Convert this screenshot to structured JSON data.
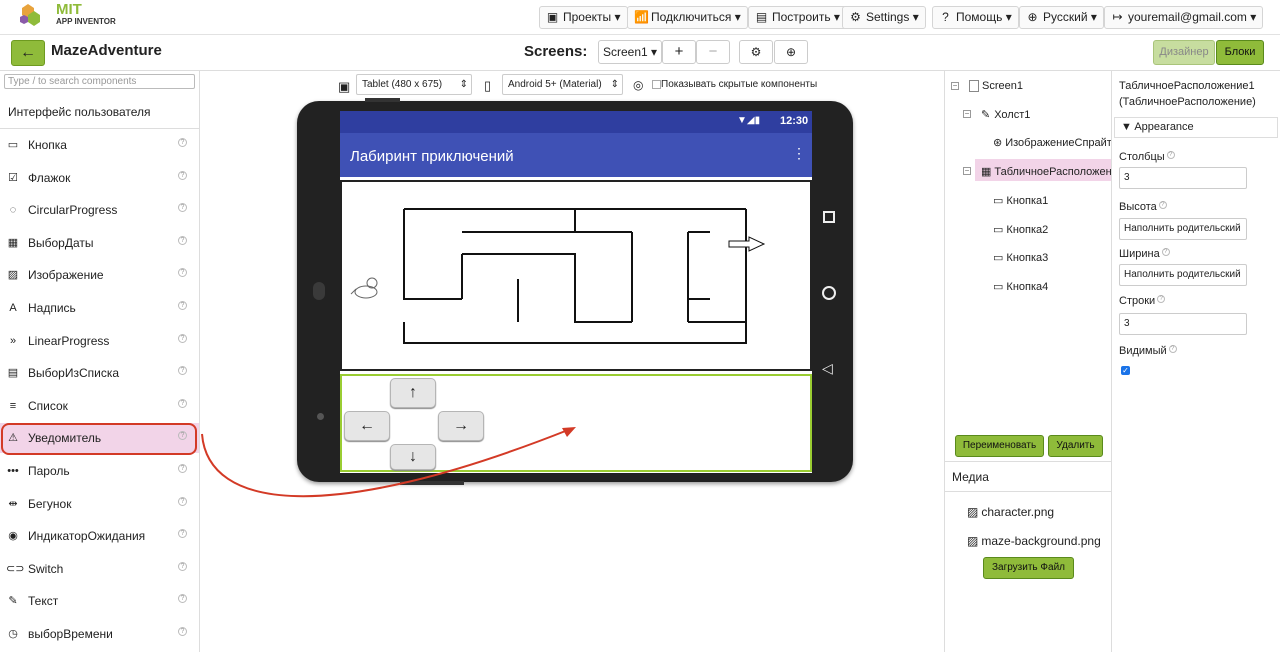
{
  "app": {
    "logo_brand": "MIT",
    "logo_sub": "APP INVENTOR"
  },
  "topbar": {
    "menus": [
      {
        "icon": "folder-icon",
        "label": "Проекты"
      },
      {
        "icon": "connect-icon",
        "label": "Подключиться"
      },
      {
        "icon": "build-icon",
        "label": "Построить"
      },
      {
        "icon": "gear-icon",
        "label": "Settings"
      },
      {
        "icon": "help-icon",
        "label": "Помощь"
      },
      {
        "icon": "globe-icon",
        "label": "Русский"
      },
      {
        "icon": "account-icon",
        "label": "youremail@gmail.com"
      }
    ]
  },
  "project": {
    "name": "MazeAdventure",
    "screens_label": "Screens:",
    "screen": "Screen1",
    "add": "+",
    "remove": "−",
    "designer": "Дизайнер",
    "blocks": "Блоки"
  },
  "palette": {
    "search_placeholder": "Type / to search components",
    "category": "Интерфейс пользователя",
    "items": [
      {
        "label": "Кнопка",
        "icon": "button-icon"
      },
      {
        "label": "Флажок",
        "icon": "checkbox-icon"
      },
      {
        "label": "CircularProgress",
        "icon": "circular-progress-icon"
      },
      {
        "label": "ВыборДаты",
        "icon": "calendar-icon"
      },
      {
        "label": "Изображение",
        "icon": "image-icon"
      },
      {
        "label": "Надпись",
        "icon": "label-icon"
      },
      {
        "label": "LinearProgress",
        "icon": "linear-progress-icon"
      },
      {
        "label": "ВыборИзСписка",
        "icon": "listpicker-icon"
      },
      {
        "label": "Список",
        "icon": "listview-icon"
      },
      {
        "label": "Уведомитель",
        "icon": "warning-icon"
      },
      {
        "label": "Пароль",
        "icon": "password-icon"
      },
      {
        "label": "Бегунок",
        "icon": "slider-icon"
      },
      {
        "label": "ИндикаторОжидания",
        "icon": "spinner-icon"
      },
      {
        "label": "Switch",
        "icon": "switch-icon"
      },
      {
        "label": "Текст",
        "icon": "textbox-icon"
      },
      {
        "label": "выборВремени",
        "icon": "clock-icon"
      }
    ]
  },
  "viewer": {
    "tablet_option": "Tablet (480 x 675)",
    "theme_option": "Android 5+ (Material)",
    "hidden_label": "Показывать скрытые компоненты"
  },
  "phone": {
    "time": "12:30",
    "title": "Лабиринт приключений",
    "up": "↑",
    "left": "←",
    "right": "→",
    "down": "↓"
  },
  "tree": {
    "nodes": [
      {
        "label": "Screen1"
      },
      {
        "label": "Холст1"
      },
      {
        "label": "ИзображениеСпрайт"
      },
      {
        "label": "ТабличноеРасположение1"
      },
      {
        "label": "Кнопка1"
      },
      {
        "label": "Кнопка2"
      },
      {
        "label": "Кнопка3"
      },
      {
        "label": "Кнопка4"
      }
    ],
    "rename": "Переименовать",
    "delete": "Удалить"
  },
  "media": {
    "title": "Медиа",
    "files": [
      "character.png",
      "maze-background.png"
    ],
    "upload": "Загрузить Файл"
  },
  "properties": {
    "component_title": "ТабличноеРасположение1 (ТабличноеРасположение)",
    "section": "Appearance",
    "columns_label": "Столбцы",
    "columns_value": "3",
    "height_label": "Высота",
    "height_value": "Наполнить родительский",
    "width_label": "Ширина",
    "width_value": "Наполнить родительский",
    "rows_label": "Строки",
    "rows_value": "3",
    "visible_label": "Видимый",
    "visible_checked": true
  },
  "colors": {
    "accent_green": "#8fbb3a",
    "app_bar": "#3f51b5",
    "highlight": "#f2d4e8",
    "arrow_red": "#d33a26"
  }
}
